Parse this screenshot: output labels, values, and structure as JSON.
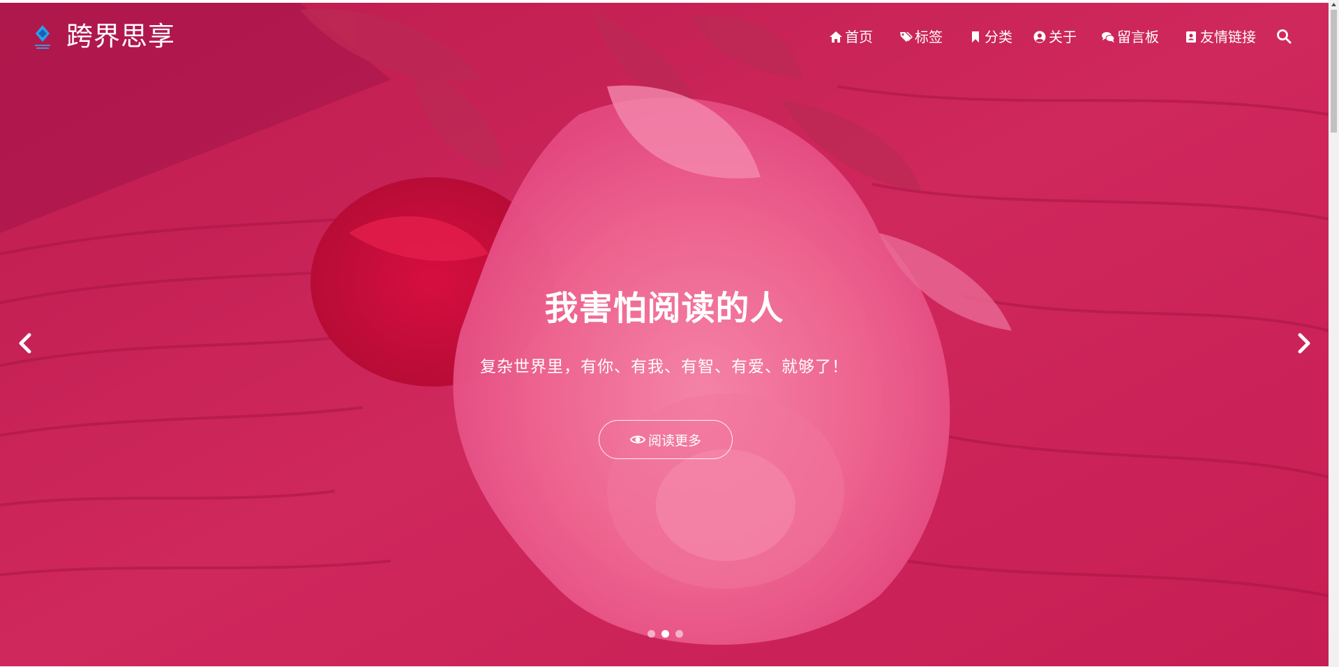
{
  "site": {
    "title": "跨界思享",
    "logo_icon": "diamond-logo-icon"
  },
  "nav": {
    "items": [
      {
        "label": "首页",
        "icon": "home-icon"
      },
      {
        "label": "标签",
        "icon": "tags-icon"
      },
      {
        "label": "分类",
        "icon": "bookmark-icon"
      },
      {
        "label": "关于",
        "icon": "user-circle-icon"
      },
      {
        "label": "留言板",
        "icon": "comments-icon"
      },
      {
        "label": "友情链接",
        "icon": "address-card-icon"
      }
    ],
    "search_icon": "search-icon"
  },
  "hero": {
    "title": "我害怕阅读的人",
    "subtitle": "复杂世界里，有你、有我、有智、有爱、就够了！",
    "button_label": "阅读更多",
    "button_icon": "eye-icon",
    "slide_count": 3,
    "active_slide": 2,
    "overlay_color": "#c81f56"
  },
  "colors": {
    "overlay": "#c81f56",
    "rose_light": "#f27aa3",
    "rose_dark": "#c5103f",
    "text": "#ffffff"
  }
}
